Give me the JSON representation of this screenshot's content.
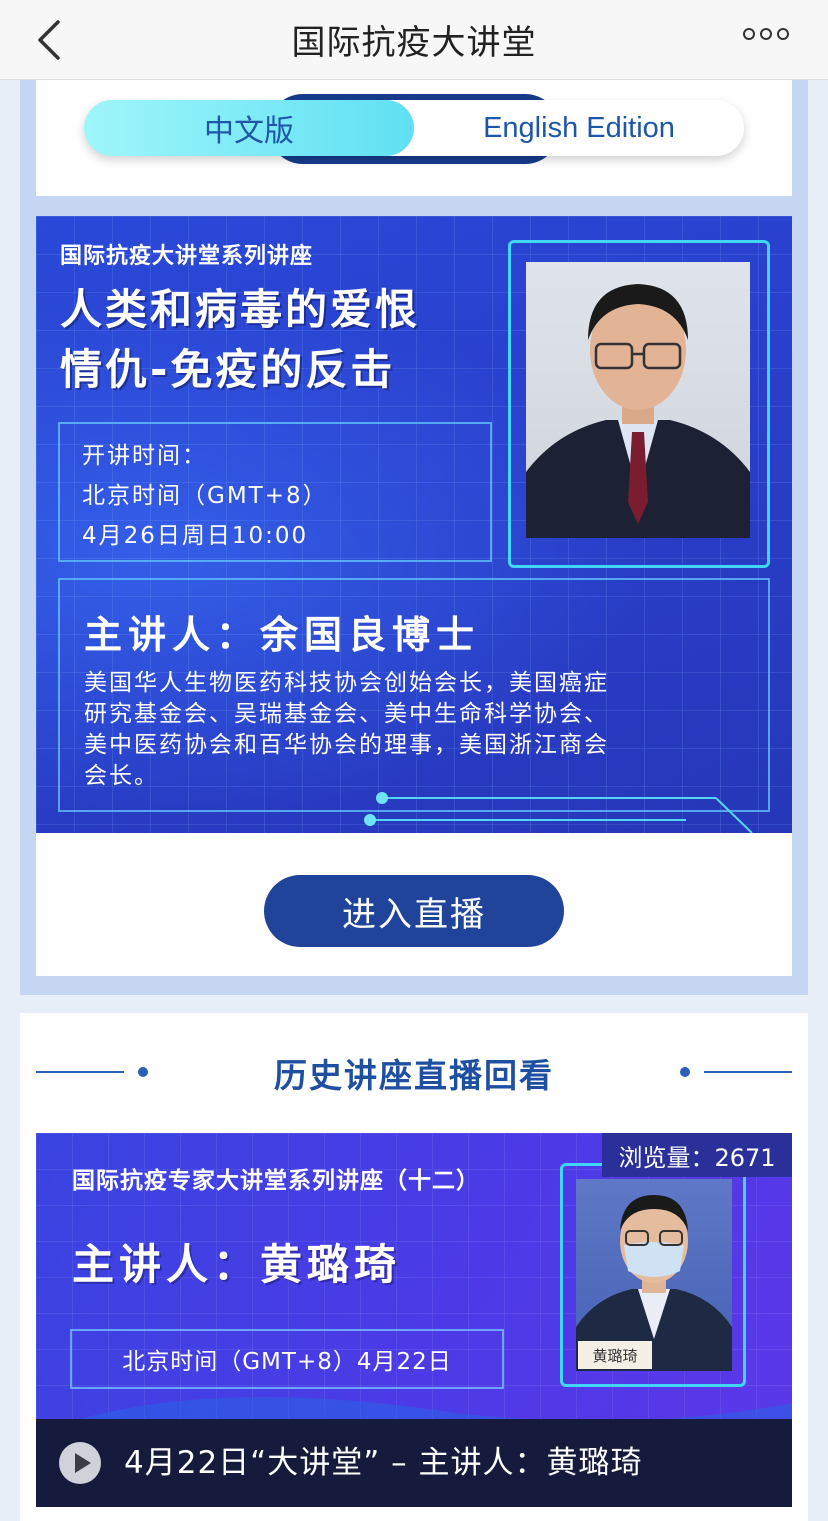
{
  "nav": {
    "title": "国际抗疫大讲堂",
    "back_icon": "chevron-left-icon",
    "more_icon": "more-dots-icon"
  },
  "lang_toggle": {
    "chinese_label": "中文版",
    "english_label": "English Edition",
    "selected": "中文版"
  },
  "live_lecture": {
    "series": "国际抗疫大讲堂系列讲座",
    "title_line1": "人类和病毒的爱恨",
    "title_line2": "情仇-免疫的反击",
    "time_label": "开讲时间：",
    "time_zone": "北京时间（GMT+8）",
    "time_value": "4月26日周日10:00",
    "speaker": "主讲人：余国良博士",
    "bio_line1": "美国华人生物医药科技协会创始会长，美国癌症",
    "bio_line2": "研究基金会、吴瑞基金会、美中生命科学协会、",
    "bio_line3": "美中医药协会和百华协会的理事，美国浙江商会",
    "bio_line4": "会长。",
    "enter_button": "进入直播"
  },
  "history": {
    "title": "历史讲座直播回看",
    "items": [
      {
        "views": "浏览量：2671",
        "series": "国际抗疫专家大讲堂系列讲座（十二）",
        "speaker": "主讲人：黄璐琦",
        "time": "北京时间（GMT+8）4月22日",
        "name_plate": "黄璐琦",
        "caption": "4月22日“大讲堂” – 主讲人：黄璐琦",
        "play_icon": "play-icon"
      }
    ]
  },
  "colors": {
    "primary": "#1f449a",
    "accent_cyan": "#5fe0f2",
    "banner_blue": "#2a49d8",
    "text_blue": "#1f4fa0"
  }
}
